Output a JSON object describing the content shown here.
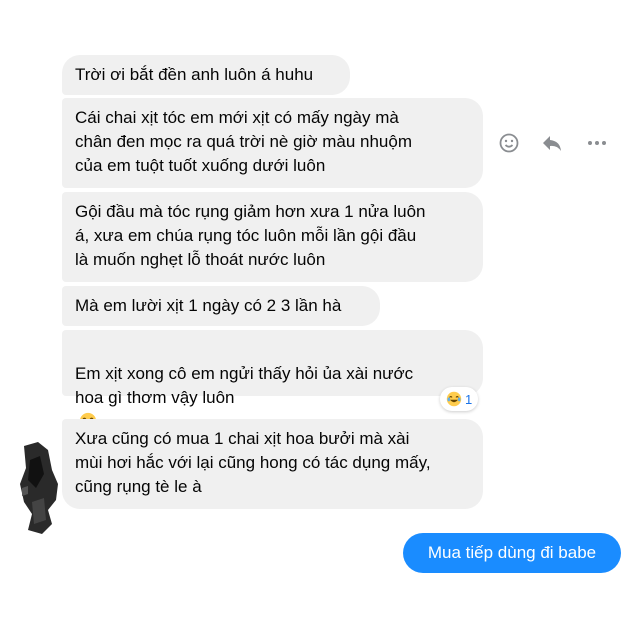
{
  "conversation": {
    "received_messages": [
      {
        "text": "Trời ơi bắt đền anh luôn á huhu"
      },
      {
        "text": "Cái chai xịt tóc em mới xịt có mấy ngày mà\nchân đen mọc ra quá trời nè giờ màu nhuộm\ncủa em tuột tuốt xuống dưới luôn"
      },
      {
        "text": "Gội đầu mà tóc rụng giảm hơn xưa 1 nửa luôn\ná, xưa em chúa rụng tóc luôn mỗi lần gội đầu\nlà muốn nghẹt lỗ thoát nước luôn"
      },
      {
        "text": "Mà em lười xịt 1 ngày có 2 3 lần hà"
      },
      {
        "text": "Em xịt xong cô em ngửi thấy hỏi ủa xài nước\nhoa gì thơm vậy luôn"
      },
      {
        "text": "Xưa cũng có mua 1 chai xịt hoa bưởi mà xài\nmùi hơi hắc với lại cũng hong có tác dụng mấy,\ncũng rụng tè le à"
      }
    ],
    "reaction": {
      "emoji": "laughing-tears-emoji",
      "count": "1"
    },
    "sent_message": {
      "text": "Mua tiếp dùng đi babe"
    }
  },
  "hover_actions": {
    "icons": [
      "smiley-icon",
      "reply-icon",
      "more-icon"
    ]
  },
  "colors": {
    "received_bubble": "#f0f0f0",
    "sent_bubble": "#1a8cff",
    "icon_gray": "#8a8d91",
    "reaction_count": "#1a73e8"
  }
}
